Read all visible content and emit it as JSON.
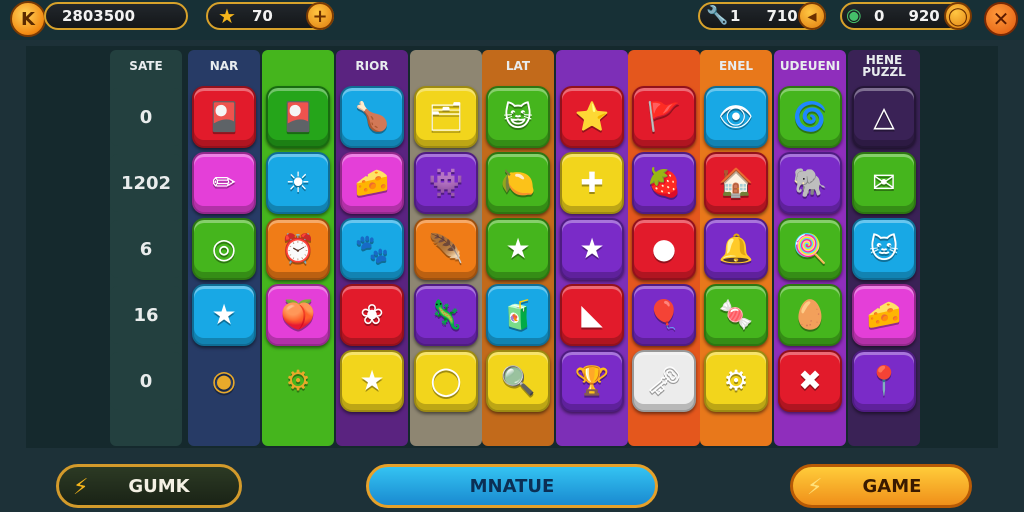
{
  "hud": {
    "score_value": "2803500",
    "stars_value": "70",
    "resource1_value": "1",
    "resource1_extra": "710",
    "resource2_value": "0",
    "resource2_extra": "920"
  },
  "columns": [
    {
      "header": "SATE",
      "color": "#23403f"
    },
    {
      "header": "NAR",
      "color": "#273b66"
    },
    {
      "header": "",
      "color": "#45b51d"
    },
    {
      "header": "RIOR",
      "color": "#5a2380"
    },
    {
      "header": "",
      "color": "#8e8672"
    },
    {
      "header": "LAT",
      "color": "#c26a1b"
    },
    {
      "header": "",
      "color": "#7d2fb7"
    },
    {
      "header": "",
      "color": "#e4571d"
    },
    {
      "header": "ENEL",
      "color": "#e8781b"
    },
    {
      "header": "UDEUENI",
      "color": "#8f2ebc"
    },
    {
      "header": "HENE PUZZL",
      "color": "#3a2256"
    }
  ],
  "score_rows": [
    "0",
    "1202",
    "6",
    "16",
    "0"
  ],
  "tiles": [
    [
      "🎴",
      "🎴",
      "🍗",
      "🗂",
      "😺",
      "⭐",
      "🚩",
      "👁",
      "🌀",
      "△"
    ],
    [
      "✏",
      "☀",
      "🧀",
      "👾",
      "🍋",
      "✚",
      "🍓",
      "🏠",
      "🐘",
      "✉"
    ],
    [
      "◎",
      "⏰",
      "🐾",
      "🪶",
      "★",
      "★",
      "●",
      "🔔",
      "🍭",
      "🐱"
    ],
    [
      "★",
      "🍑",
      "❀",
      "🦎",
      "🧃",
      "◣",
      "🎈",
      "🍬",
      "🥚",
      "🧀"
    ],
    [
      "◉",
      "⚙",
      "★",
      "◯",
      "🔍",
      "🏆",
      "🗝",
      "⚙",
      "✖",
      "📍"
    ]
  ],
  "tile_colors": [
    [
      "#e21b2b",
      "#25a51a",
      "#18a8e5",
      "#f2d51c",
      "#45b51d",
      "#e21b2b",
      "#e21b2b",
      "#18a8e5",
      "#45b51d",
      "#3a2256"
    ],
    [
      "#e43fd8",
      "#18a8e5",
      "#e43fd8",
      "#7a2bc8",
      "#45b51d",
      "#f2d51c",
      "#7a2bc8",
      "#e21b2b",
      "#7a2bc8",
      "#45b51d"
    ],
    [
      "#45b51d",
      "#f07c17",
      "#18a8e5",
      "#f07c17",
      "#45b51d",
      "#7a2bc8",
      "#e21b2b",
      "#7a2bc8",
      "#45b51d",
      "#18a8e5"
    ],
    [
      "#18a8e5",
      "#e43fd8",
      "#e21b2b",
      "#7a2bc8",
      "#18a8e5",
      "#e21b2b",
      "#7a2bc8",
      "#45b51d",
      "#45b51d",
      "#e43fd8"
    ],
    [
      "#none",
      "#none",
      "#f2d51c",
      "#f2d51c",
      "#f2d51c",
      "#7a2bc8",
      "#ececec",
      "#f2d51c",
      "#e21b2b",
      "#7a2bc8"
    ]
  ],
  "buttons": {
    "left_label": "GUMK",
    "center_label": "MNATUE",
    "right_label": "GAME"
  }
}
